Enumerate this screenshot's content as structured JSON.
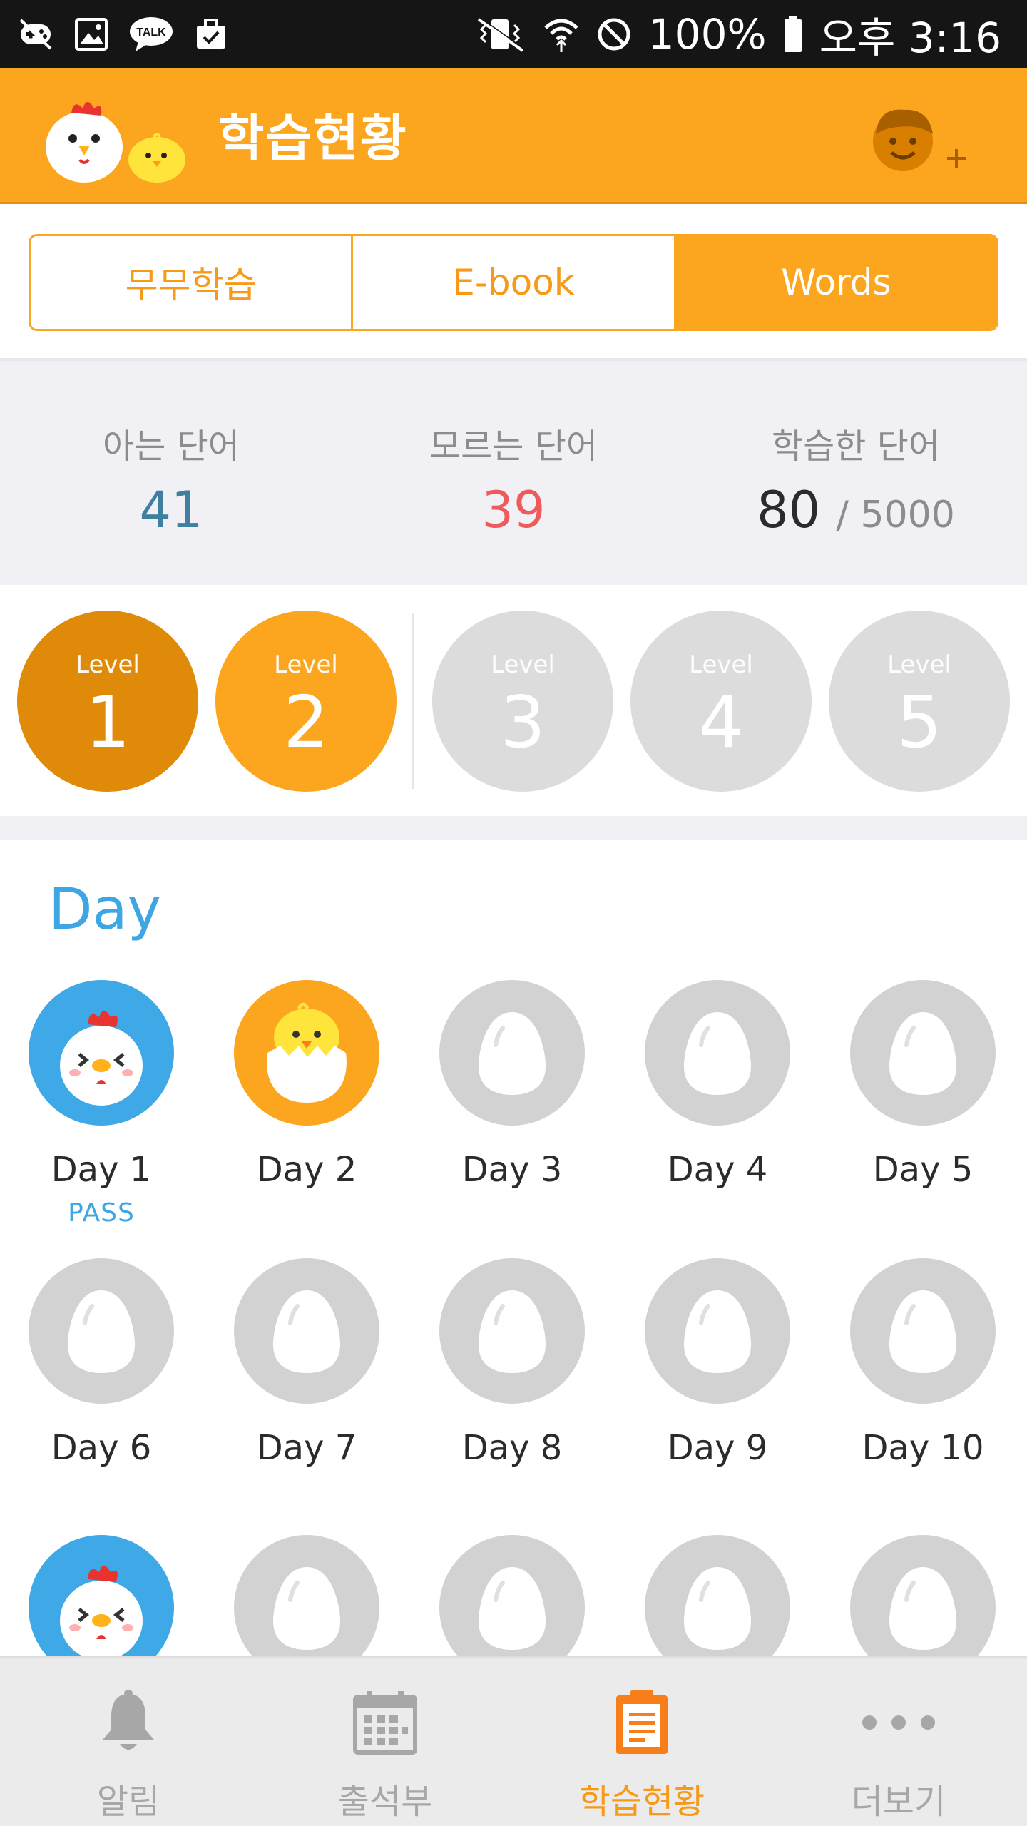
{
  "status_bar": {
    "battery": "100%",
    "time": "오후 3:16",
    "left_icons": [
      "game-icon",
      "gallery-icon",
      "talk-icon",
      "briefcase-icon"
    ],
    "right_icons": [
      "vibrate-icon",
      "wifi-icon",
      "do-not-disturb-icon",
      "battery-icon"
    ],
    "talk_badge": "TALK"
  },
  "header": {
    "title": "학습현황",
    "left_icon": "chicken-mascot-icon",
    "right_icon": "add-profile-icon"
  },
  "tabs": [
    {
      "label": "무무학습",
      "active": false
    },
    {
      "label": "E-book",
      "active": false
    },
    {
      "label": "Words",
      "active": true
    }
  ],
  "stats": {
    "known_label": "아는 단어",
    "known_value": "41",
    "unknown_label": "모르는 단어",
    "unknown_value": "39",
    "learned_label": "학습한 단어",
    "learned_value": "80",
    "learned_total": "/ 5000"
  },
  "levels": [
    {
      "label": "Level",
      "number": "1",
      "state": "done"
    },
    {
      "label": "Level",
      "number": "2",
      "state": "current"
    },
    {
      "label": "Level",
      "number": "3",
      "state": "locked"
    },
    {
      "label": "Level",
      "number": "4",
      "state": "locked"
    },
    {
      "label": "Level",
      "number": "5",
      "state": "locked"
    }
  ],
  "days": {
    "title": "Day",
    "items": [
      {
        "label": "Day 1",
        "sub": "PASS",
        "state": "pass",
        "icon": "chicken-icon"
      },
      {
        "label": "Day 2",
        "sub": "",
        "state": "current",
        "icon": "hatching-chick-icon"
      },
      {
        "label": "Day 3",
        "sub": "",
        "state": "locked",
        "icon": "egg-icon"
      },
      {
        "label": "Day 4",
        "sub": "",
        "state": "locked",
        "icon": "egg-icon"
      },
      {
        "label": "Day 5",
        "sub": "",
        "state": "locked",
        "icon": "egg-icon"
      },
      {
        "label": "Day 6",
        "sub": "",
        "state": "locked",
        "icon": "egg-icon"
      },
      {
        "label": "Day 7",
        "sub": "",
        "state": "locked",
        "icon": "egg-icon"
      },
      {
        "label": "Day 8",
        "sub": "",
        "state": "locked",
        "icon": "egg-icon"
      },
      {
        "label": "Day 9",
        "sub": "",
        "state": "locked",
        "icon": "egg-icon"
      },
      {
        "label": "Day 10",
        "sub": "",
        "state": "locked",
        "icon": "egg-icon"
      },
      {
        "label": "",
        "sub": "",
        "state": "pass",
        "icon": "chicken-icon"
      },
      {
        "label": "",
        "sub": "",
        "state": "locked",
        "icon": "egg-icon"
      },
      {
        "label": "",
        "sub": "",
        "state": "locked",
        "icon": "egg-icon"
      },
      {
        "label": "",
        "sub": "",
        "state": "locked",
        "icon": "egg-icon"
      },
      {
        "label": "",
        "sub": "",
        "state": "locked",
        "icon": "egg-icon"
      }
    ]
  },
  "bottom_nav": [
    {
      "label": "알림",
      "icon": "bell-icon",
      "active": false
    },
    {
      "label": "출석부",
      "icon": "calendar-icon",
      "active": false
    },
    {
      "label": "학습현황",
      "icon": "clipboard-icon",
      "active": true
    },
    {
      "label": "더보기",
      "icon": "more-icon",
      "active": false
    }
  ],
  "colors": {
    "accent": "#fca51e",
    "accent_dark": "#df8a08",
    "pass_blue": "#3fa8e6",
    "known": "#3f7f9f",
    "unknown": "#ef5a5a",
    "locked": "#d2d2d2"
  }
}
